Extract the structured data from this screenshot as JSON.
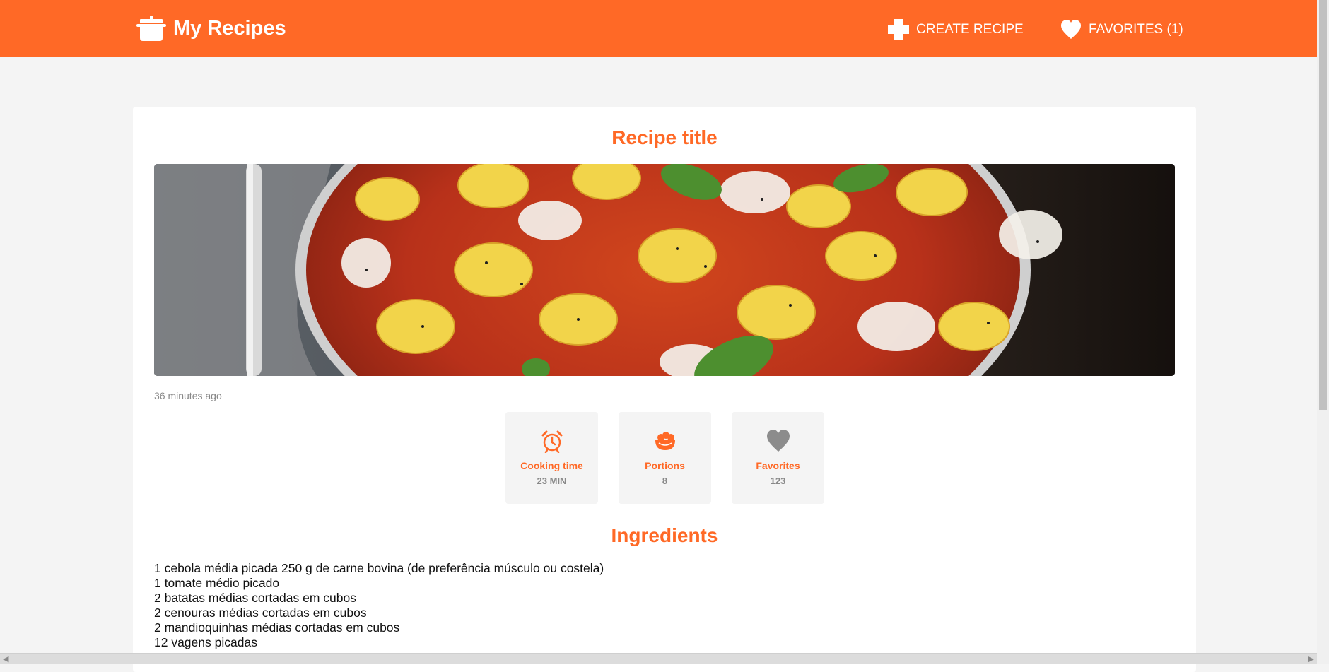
{
  "header": {
    "brand_title": "My Recipes",
    "create_label": "CREATE RECIPE",
    "favorites_label": "FAVORITES (1)",
    "brand_icon": "cooking-pot-icon",
    "create_icon": "plus-icon",
    "favorites_icon": "heart-icon",
    "accent_color": "#ff6926"
  },
  "recipe": {
    "title": "Recipe title",
    "image_alt": "gnocchi",
    "timestamp": "36 minutes ago",
    "stats": [
      {
        "label": "Cooking time",
        "value": "23 MIN",
        "icon": "alarm-clock-icon"
      },
      {
        "label": "Portions",
        "value": "8",
        "icon": "food-bowl-icon"
      },
      {
        "label": "Favorites",
        "value": "123",
        "icon": "heart-icon"
      }
    ],
    "ingredients_title": "Ingredients",
    "ingredients": [
      "1 cebola média picada 250 g de carne bovina (de preferência músculo ou costela)",
      "1 tomate médio picado",
      "2 batatas médias cortadas em cubos",
      "2 cenouras médias cortadas em cubos",
      "2 mandioquinhas médias cortadas em cubos",
      "12 vagens picadas"
    ]
  }
}
